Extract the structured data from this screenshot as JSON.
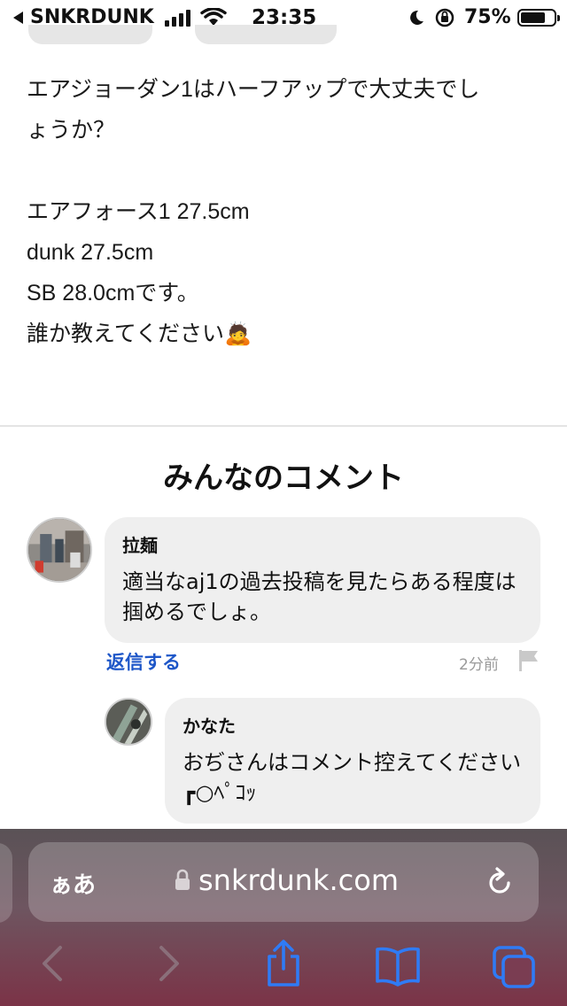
{
  "status_bar": {
    "back_app": "SNKRDUNK",
    "time": "23:35",
    "battery_percent": "75%",
    "battery_level": 0.75
  },
  "post": {
    "lines": [
      "エアジョーダン1はハーフアップで大丈夫でし",
      "ょうか？",
      "",
      "エアフォース1 27.5cm",
      "dunk 27.5cm",
      "SB 28.0cmです。",
      "誰か教えてください🙇"
    ]
  },
  "comments": {
    "heading": "みんなのコメント",
    "items": [
      {
        "author": "拉麺",
        "text": "適当なaj1の過去投稿を見たらある程度は掴めるでしょ。",
        "reply_label": "返信する",
        "time_ago": "2分前"
      }
    ],
    "replies": [
      {
        "author": "かなた",
        "text": "おぢさんはコメント控えてください ┏○ﾍﾟｺｯ"
      }
    ]
  },
  "browser": {
    "text_size_label": "ぁあ",
    "domain": "snkrdunk.com"
  },
  "colors": {
    "link": "#1d56c8",
    "bubble": "#efefef",
    "ios_blue": "#2f7bf5"
  },
  "icons": [
    "back-arrow-icon",
    "signal-icon",
    "wifi-icon",
    "moon-icon",
    "orientation-lock-icon",
    "battery-icon",
    "flag-icon",
    "lock-icon",
    "reload-icon",
    "chevron-left-icon",
    "chevron-right-icon",
    "share-icon",
    "bookmarks-icon",
    "tabs-icon"
  ]
}
